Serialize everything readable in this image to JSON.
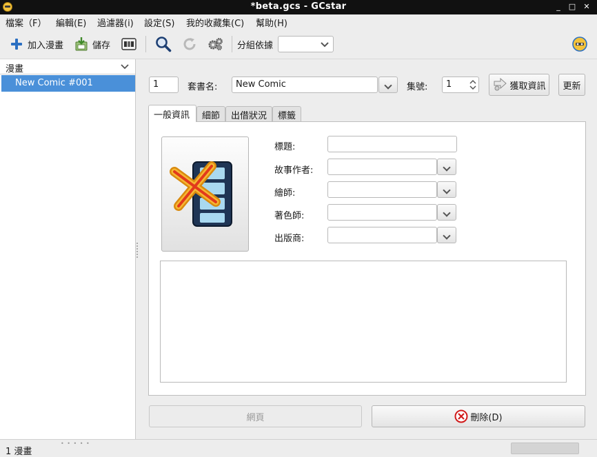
{
  "window": {
    "title": "*beta.gcs - GCstar",
    "minimize": "_",
    "maximize": "□",
    "close": "✕"
  },
  "menubar": {
    "items": [
      {
        "label": "檔案（F）"
      },
      {
        "label": "編輯(E)"
      },
      {
        "label": "過濾器(i)"
      },
      {
        "label": "設定(S)"
      },
      {
        "label": "我的收藏集(C)"
      },
      {
        "label": "幫助(H)"
      }
    ]
  },
  "toolbar": {
    "add_label": "加入漫畫",
    "save_label": "儲存",
    "group_label": "分組依據",
    "group_value": ""
  },
  "sidebar": {
    "header": "漫畫",
    "items": [
      {
        "label": "New Comic #001"
      }
    ]
  },
  "form": {
    "number_value": "1",
    "series_label": "套書名:",
    "series_value": "New Comic",
    "volume_label": "集號:",
    "volume_value": "1",
    "fetch_label": "獲取資訊",
    "update_label": "更新"
  },
  "tabs": [
    {
      "label": "一般資訊"
    },
    {
      "label": "細節"
    },
    {
      "label": "出借狀況"
    },
    {
      "label": "標籤"
    }
  ],
  "fields": {
    "title_label": "標題:",
    "writer_label": "故事作者:",
    "illustrator_label": "繪師:",
    "colorist_label": "著色師:",
    "publisher_label": "出版商:"
  },
  "actions": {
    "webpage_label": "網頁",
    "delete_label": "刪除(D)"
  },
  "status": {
    "text": "1 漫畫"
  },
  "colors": {
    "accent": "#4a90d9",
    "titlebar": "#111111",
    "toolbar_icon_blue": "#2b6fc2"
  }
}
